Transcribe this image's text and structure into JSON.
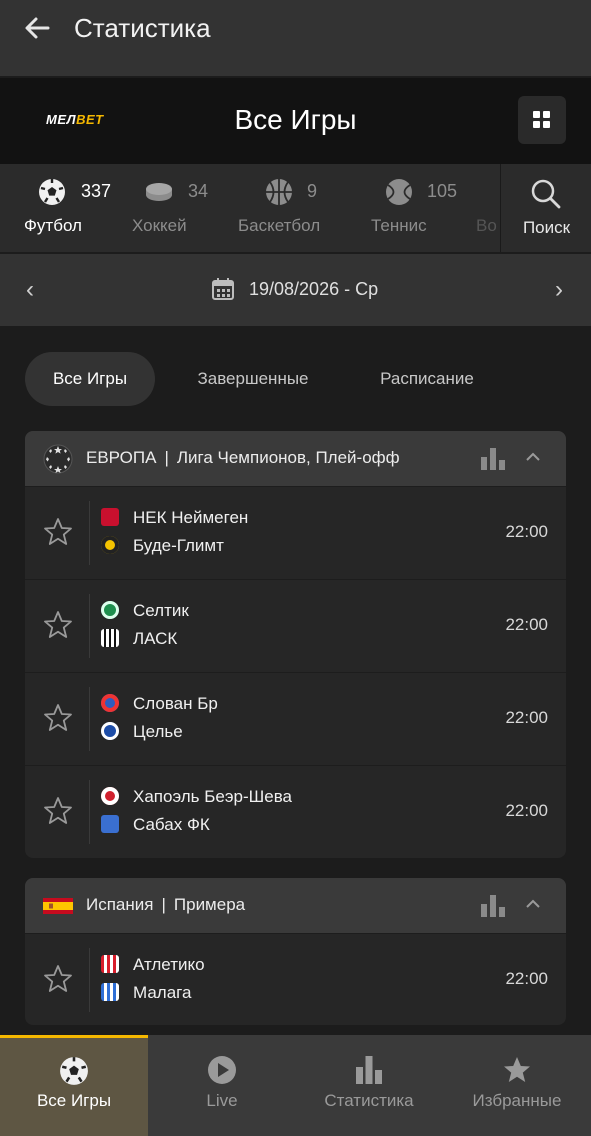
{
  "topbar": {
    "title": "Статистика"
  },
  "header": {
    "logo_part1": "МЕЛ",
    "logo_part2": "BET",
    "title": "Все Игры"
  },
  "sports": [
    {
      "label": "Футбол",
      "count": "337",
      "icon": "soccer-ball-icon"
    },
    {
      "label": "Хоккей",
      "count": "34",
      "icon": "hockey-puck-icon"
    },
    {
      "label": "Баскетбол",
      "count": "9",
      "icon": "basketball-icon"
    },
    {
      "label": "Теннис",
      "count": "105",
      "icon": "tennis-ball-icon"
    },
    {
      "label": "Во",
      "count": "",
      "icon": ""
    }
  ],
  "search": {
    "label": "Поиск"
  },
  "datebar": {
    "prev": "‹",
    "date": "19/08/2026 - Ср",
    "next": "›"
  },
  "filters": [
    {
      "label": "Все Игры"
    },
    {
      "label": "Завершенные"
    },
    {
      "label": "Расписание"
    }
  ],
  "leagues": [
    {
      "region": "ЕВРОПА",
      "name": "Лига Чемпионов, Плей-офф",
      "matches": [
        {
          "home": "НЕК Неймеген",
          "away": "Буде-Глимт",
          "time": "22:00"
        },
        {
          "home": "Селтик",
          "away": "ЛАСК",
          "time": "22:00"
        },
        {
          "home": "Слован Бр",
          "away": "Целье",
          "time": "22:00"
        },
        {
          "home": "Хапоэль Беэр-Шева",
          "away": "Сабах ФК",
          "time": "22:00"
        }
      ]
    },
    {
      "region": "Испания",
      "name": "Примера",
      "matches": [
        {
          "home": "Атлетико",
          "away": "Малага",
          "time": "22:00"
        }
      ]
    }
  ],
  "bottom_nav": [
    {
      "label": "Все Игры"
    },
    {
      "label": "Live"
    },
    {
      "label": "Статистика"
    },
    {
      "label": "Избранные"
    }
  ],
  "colors": {
    "accent": "#f5b800",
    "background": "#1c1c1c",
    "card": "#262626",
    "card_header": "#3a3a3a"
  }
}
